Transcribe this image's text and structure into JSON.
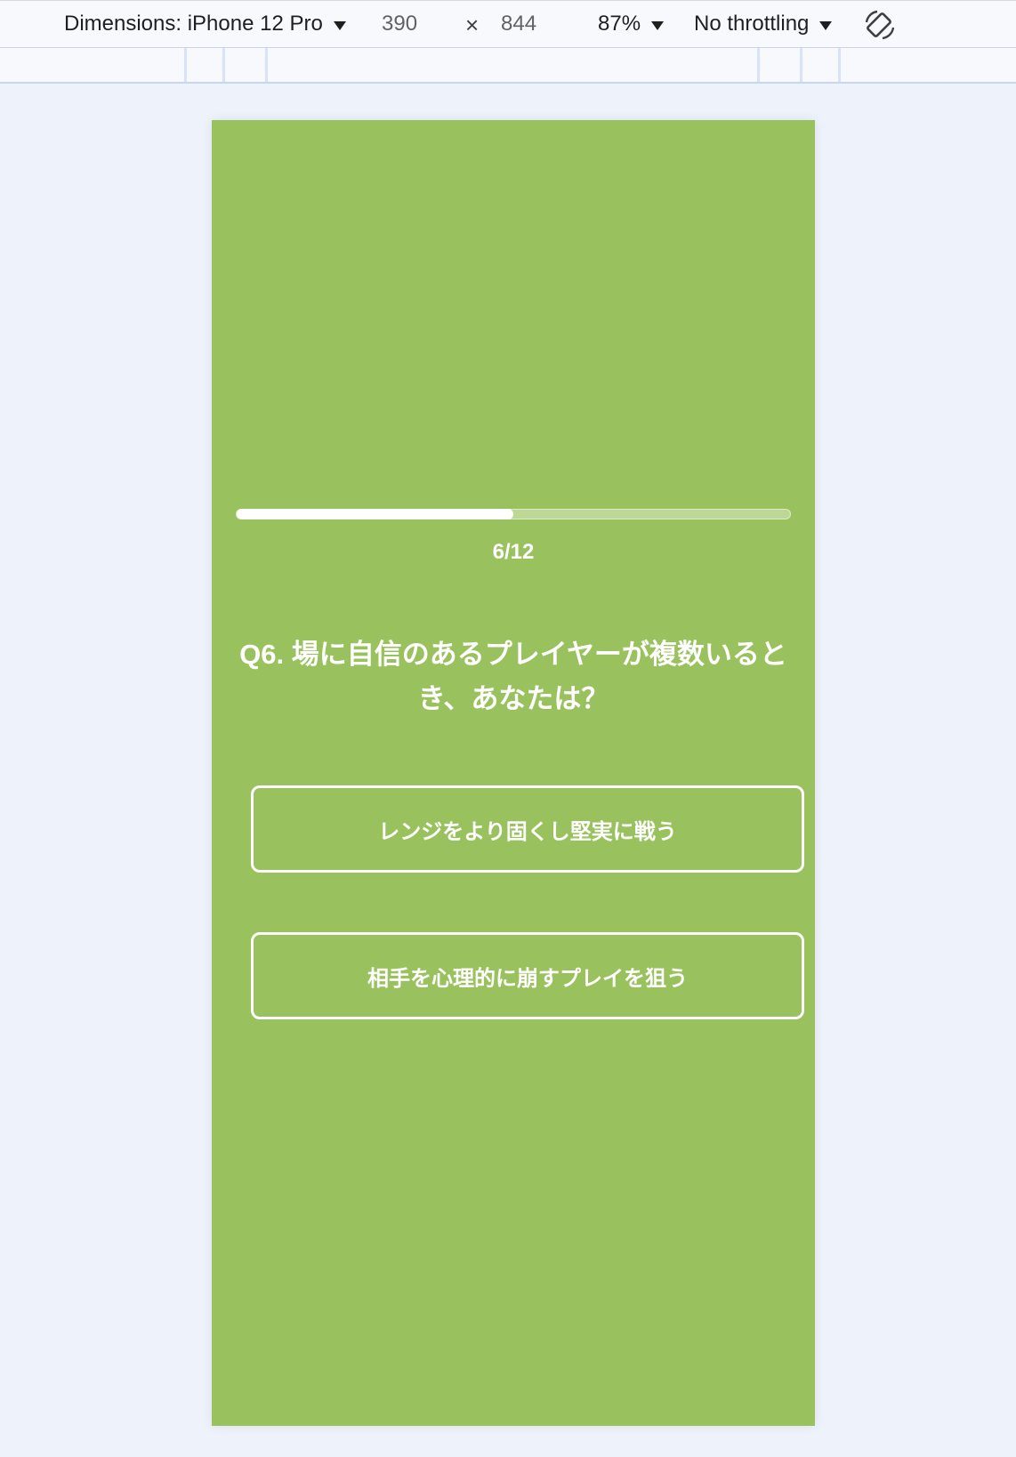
{
  "devtools": {
    "dimensions_label": "Dimensions: iPhone 12 Pro",
    "width": "390",
    "times": "×",
    "height": "844",
    "zoom": "87%",
    "throttling": "No throttling",
    "rotate_icon": "rotate-icon"
  },
  "quiz": {
    "background_color": "#99c25e",
    "progress": {
      "current": 6,
      "total": 12,
      "fraction": 0.5,
      "label": "6/12"
    },
    "question": "Q6. 場に自信のあるプレイヤーが複数いるとき、あなたは？",
    "options": [
      {
        "label": "レンジをより固くし堅実に戦う"
      },
      {
        "label": "相手を心理的に崩すプレイを狙う"
      }
    ]
  }
}
